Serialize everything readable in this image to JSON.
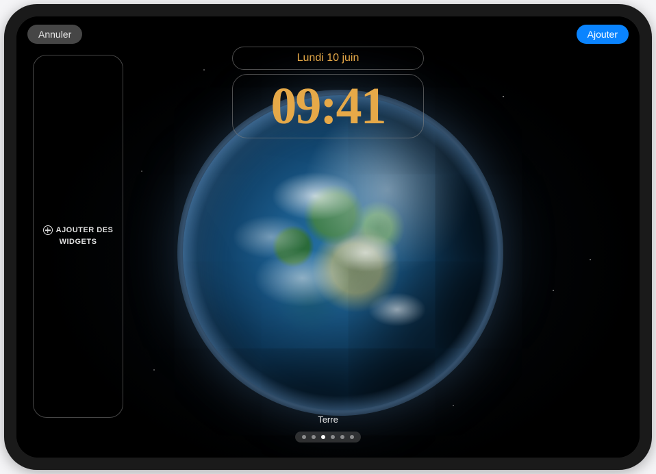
{
  "buttons": {
    "cancel": "Annuler",
    "add": "Ajouter"
  },
  "date": "Lundi 10 juin",
  "time": "09:41",
  "widgets": {
    "add_label_line1": "AJOUTER DES",
    "add_label_line2": "WIDGETS",
    "icon": "plus-circle-icon"
  },
  "wallpaper": {
    "name": "Terre"
  },
  "pagination": {
    "total": 6,
    "active_index": 2
  },
  "colors": {
    "accent_time": "#e6a948",
    "primary_button": "#0a84ff"
  }
}
